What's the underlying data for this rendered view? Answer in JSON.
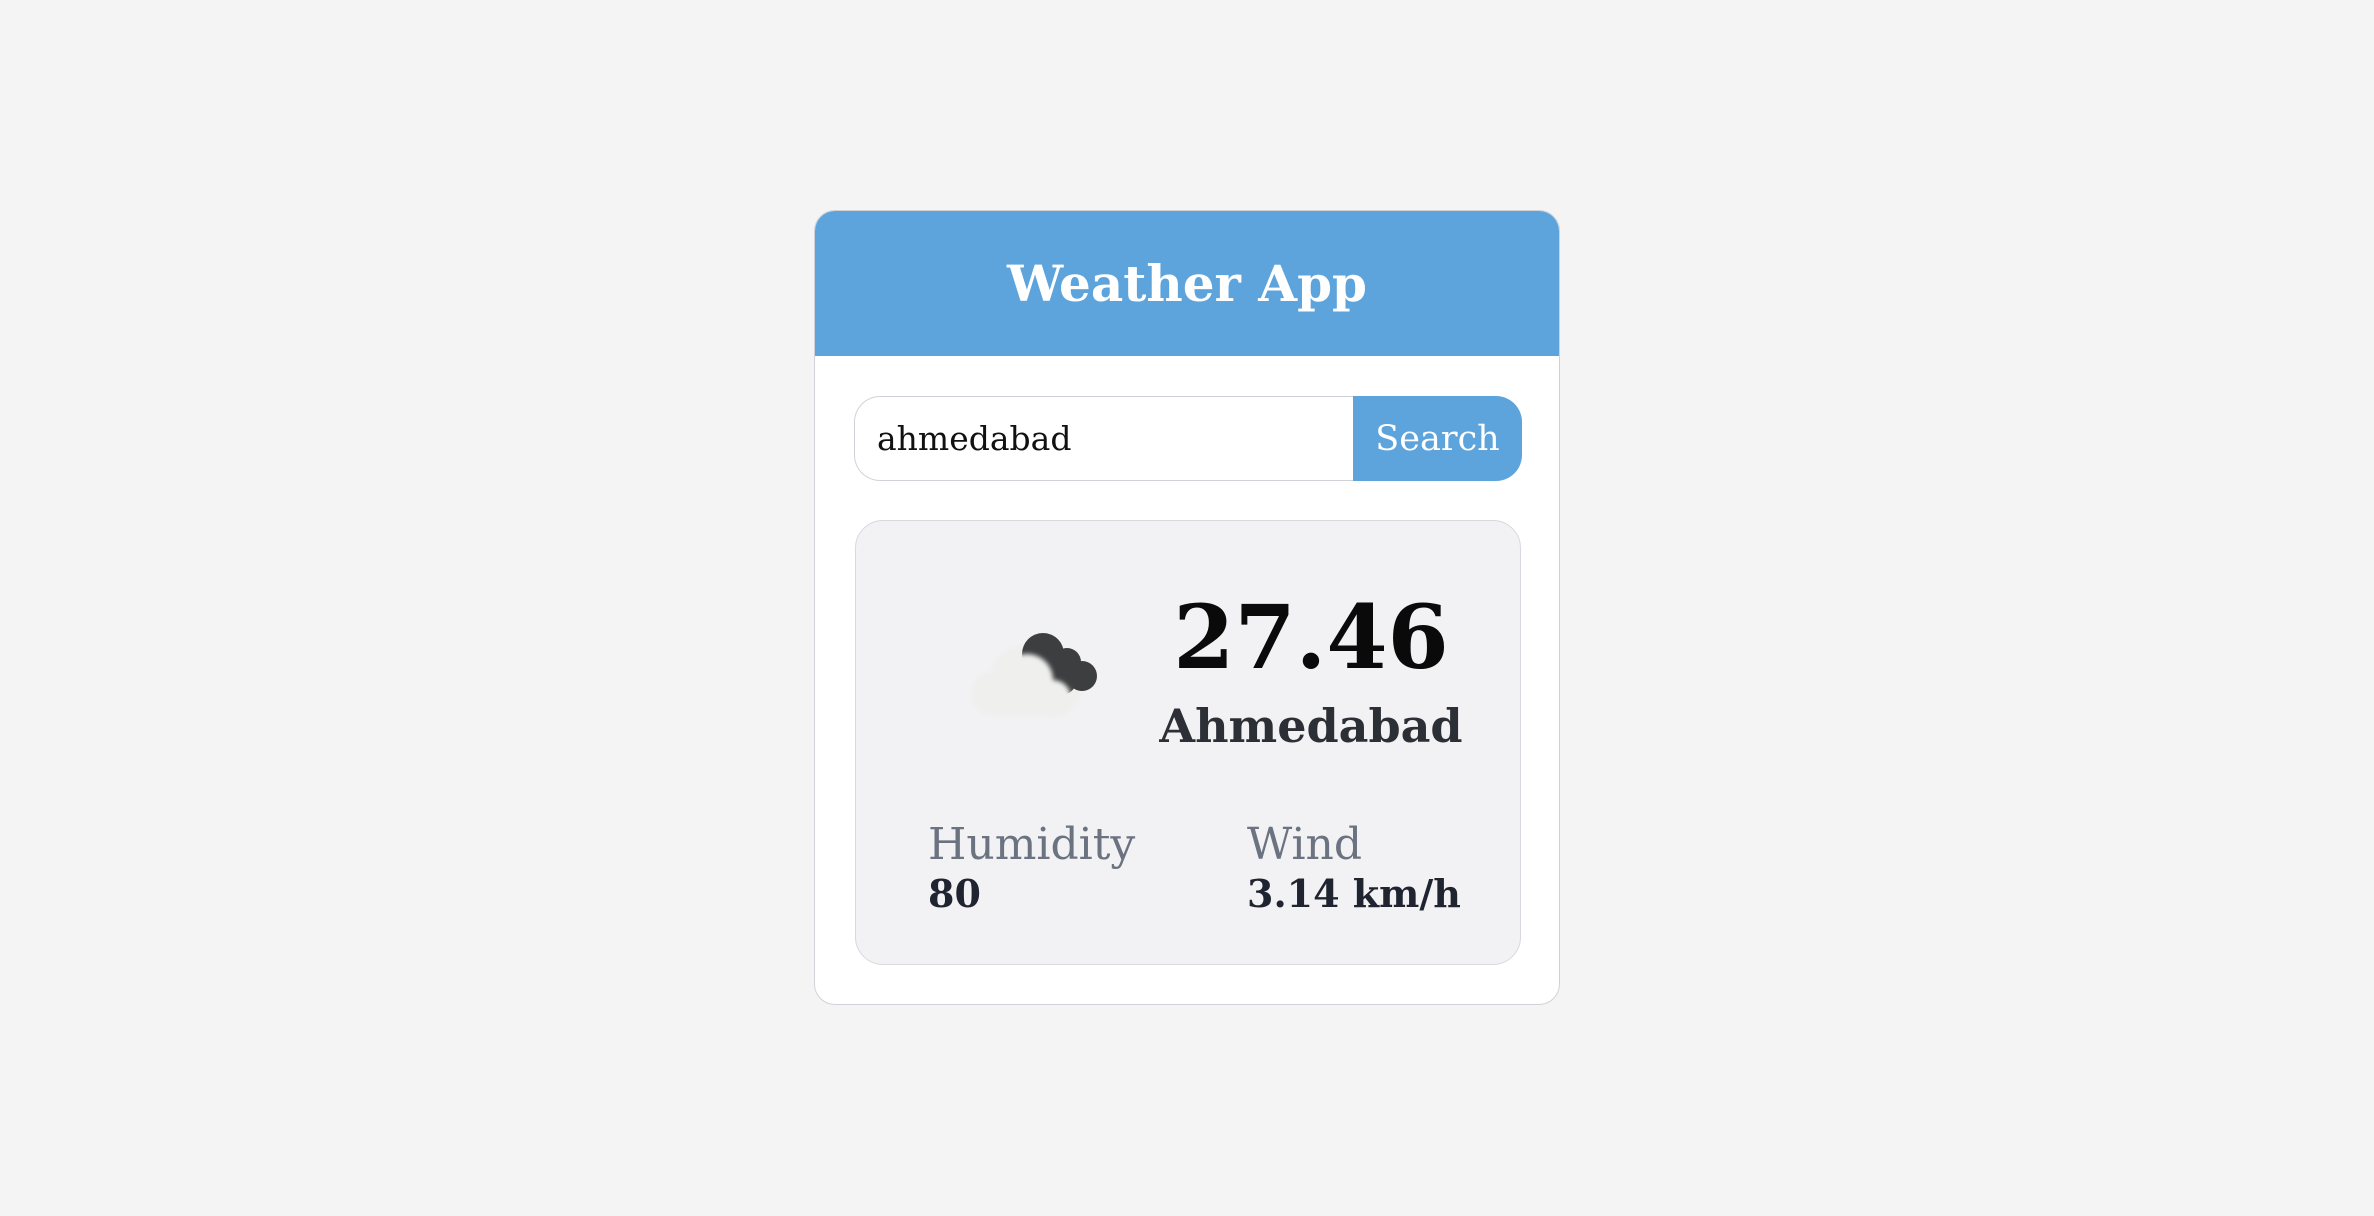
{
  "header": {
    "title": "Weather App"
  },
  "search": {
    "value": "ahmedabad",
    "button_label": "Search"
  },
  "weather": {
    "icon": "cloud-icon",
    "temperature": "27.46",
    "city": "Ahmedabad",
    "humidity_label": "Humidity",
    "humidity_value": "80",
    "wind_label": "Wind",
    "wind_value": "3.14 km/h"
  },
  "colors": {
    "accent": "#5ea4dc",
    "background": "#f4f4f4",
    "card": "#f2f2f4",
    "muted_text": "#6b7280"
  }
}
